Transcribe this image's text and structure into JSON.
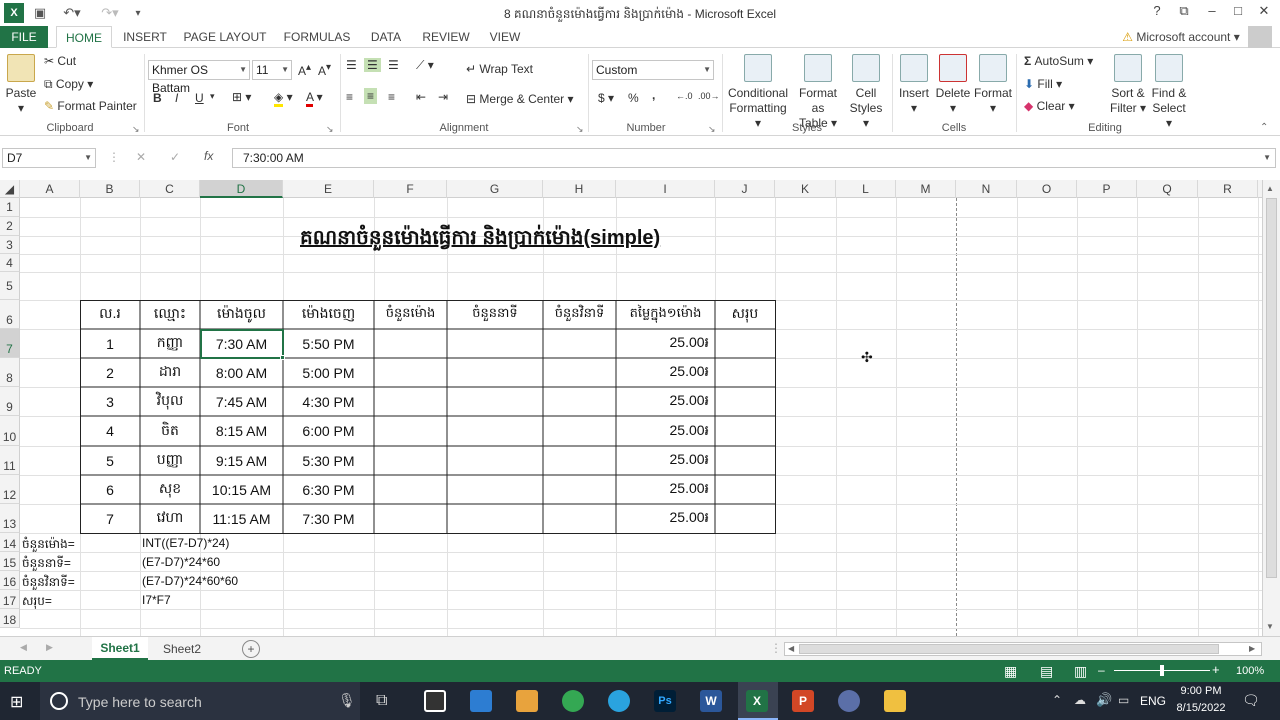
{
  "window": {
    "title": "8 គណនាចំនួនម៉ោងធ្វើការ និងប្រាក់ម៉ោង - Microsoft Excel",
    "help": "?",
    "account": "Microsoft account"
  },
  "tabs": [
    "FILE",
    "HOME",
    "INSERT",
    "PAGE LAYOUT",
    "FORMULAS",
    "DATA",
    "REVIEW",
    "VIEW"
  ],
  "ribbon": {
    "clipboard": {
      "paste": "Paste",
      "cut": "Cut",
      "copy": "Copy",
      "format_painter": "Format Painter",
      "label": "Clipboard"
    },
    "font": {
      "name": "Khmer OS Battam",
      "size": "11",
      "bold": "B",
      "italic": "I",
      "underline": "U",
      "label": "Font"
    },
    "alignment": {
      "wrap_text": "Wrap Text",
      "merge_center": "Merge & Center",
      "label": "Alignment"
    },
    "number": {
      "format": "Custom",
      "currency": "$",
      "percent": "%",
      "comma": ",",
      "label": "Number"
    },
    "styles": {
      "conditional_formatting": [
        "Conditional",
        "Formatting"
      ],
      "format_as_table": [
        "Format as",
        "Table"
      ],
      "cell_styles": [
        "Cell",
        "Styles"
      ],
      "label": "Styles"
    },
    "cells": {
      "insert": "Insert",
      "delete": "Delete",
      "format": "Format",
      "label": "Cells"
    },
    "editing": {
      "autosum": "AutoSum",
      "fill": "Fill",
      "clear": "Clear",
      "sort_filter": [
        "Sort &",
        "Filter"
      ],
      "find_select": [
        "Find &",
        "Select"
      ],
      "label": "Editing"
    }
  },
  "formula_bar": {
    "name_box": "D7",
    "fx": "fx",
    "value": "7:30:00 AM"
  },
  "columns": [
    "A",
    "B",
    "C",
    "D",
    "E",
    "F",
    "G",
    "H",
    "I",
    "J",
    "K",
    "L",
    "M",
    "N",
    "O",
    "P",
    "Q",
    "R"
  ],
  "rows": [
    "1",
    "2",
    "3",
    "4",
    "5",
    "6",
    "7",
    "8",
    "9",
    "10",
    "11",
    "12",
    "13",
    "14",
    "15",
    "16",
    "17",
    "18"
  ],
  "sheet": {
    "title": "គណនាចំនួនម៉ោងធ្វើការ និងប្រាក់ម៉ោង(simple)",
    "headers": [
      "ល.រ",
      "ឈ្មោះ",
      "ម៉ោងចូល",
      "ម៉ោងចេញ",
      "ចំនួនម៉ោង",
      "ចំនួននាទី",
      "ចំនួនវិនាទី",
      "តម្លៃក្នុង១ម៉ោង",
      "សរុប"
    ],
    "table_rows": [
      [
        "1",
        "កញ្ញា",
        "7:30 AM",
        "5:50 PM",
        "",
        "",
        "",
        "25.00៛",
        ""
      ],
      [
        "2",
        "ដារា",
        "8:00 AM",
        "5:00 PM",
        "",
        "",
        "",
        "25.00៛",
        ""
      ],
      [
        "3",
        "វិបុល",
        "7:45 AM",
        "4:30 PM",
        "",
        "",
        "",
        "25.00៛",
        ""
      ],
      [
        "4",
        "ចិត",
        "8:15 AM",
        "6:00 PM",
        "",
        "",
        "",
        "25.00៛",
        ""
      ],
      [
        "5",
        "បញ្ញា",
        "9:15 AM",
        "5:30 PM",
        "",
        "",
        "",
        "25.00៛",
        ""
      ],
      [
        "6",
        "សុខ",
        "10:15 AM",
        "6:30 PM",
        "",
        "",
        "",
        "25.00៛",
        ""
      ],
      [
        "7",
        "វេហា",
        "11:15 AM",
        "7:30 PM",
        "",
        "",
        "",
        "25.00៛",
        ""
      ]
    ],
    "notes": [
      {
        "label": "ចំនួនម៉ោង=",
        "formula": "INT((E7-D7)*24)"
      },
      {
        "label": "ចំនួននាទី=",
        "formula": "(E7-D7)*24*60"
      },
      {
        "label": "ចំនួនវិនាទី=",
        "formula": "(E7-D7)*24*60*60"
      },
      {
        "label": "សរុប=",
        "formula": "I7*F7"
      }
    ]
  },
  "sheet_tabs": [
    "Sheet1",
    "Sheet2"
  ],
  "status": {
    "ready": "READY",
    "zoom": "100%"
  },
  "taskbar": {
    "search": "Type here to search",
    "lang": "ENG",
    "time": "9:00 PM",
    "date": "8/15/2022"
  }
}
